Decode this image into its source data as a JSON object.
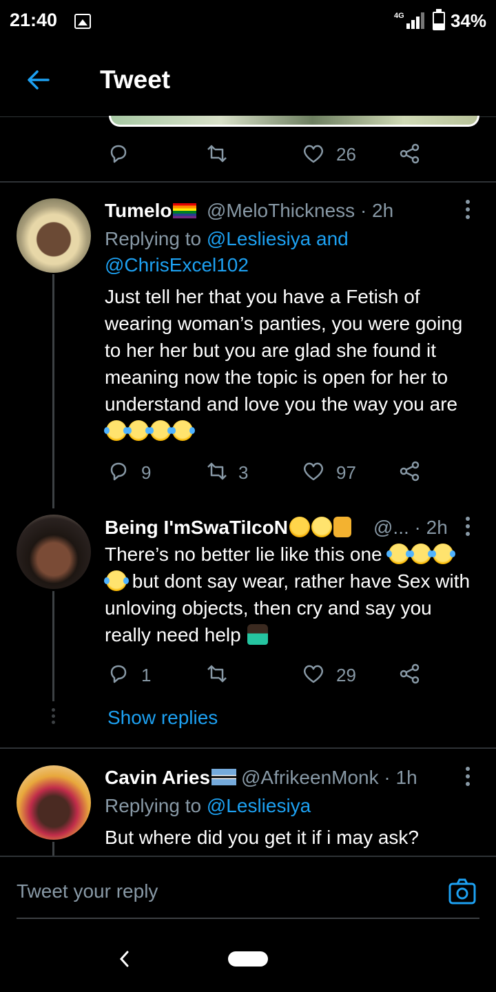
{
  "status_bar": {
    "time": "21:40",
    "network": "4G",
    "battery": "34%"
  },
  "header": {
    "title": "Tweet"
  },
  "main_tweet_actions": {
    "likes": "26"
  },
  "replies": [
    {
      "name": "Tumelo",
      "handle": "@MeloThickness",
      "time": "· 2h",
      "replying_prefix": "Replying to",
      "replying_mention1": "@Lesliesiya",
      "replying_and": "and",
      "replying_mention2": "@ChrisExcel102",
      "text": "Just tell her that you have a Fetish of wearing woman’s panties, you were going to her her but you are glad she found it meaning now the topic is open for her to understand and love you the way you are",
      "replies_count": "9",
      "retweets_count": "3",
      "likes_count": "97"
    },
    {
      "name": "Being I'mSwaTiIcoN",
      "handle": "@...",
      "time": "· 2h",
      "text_part1": "There’s no better lie like this one",
      "text_part2": "but dont say wear, rather have Sex with unloving objects, then cry and say you really need help",
      "replies_count": "1",
      "retweets_count": "",
      "likes_count": "29",
      "show_replies": "Show replies"
    },
    {
      "name": "Cavin Aries",
      "handle": "@AfrikeenMonk",
      "time": "· 1h",
      "replying_prefix": "Replying to",
      "replying_mention1": "@Lesliesiya",
      "text": "But where did you get it if i may ask?"
    }
  ],
  "compose": {
    "placeholder": "Tweet your reply"
  },
  "icons": [
    "arrow-left-icon",
    "reply-icon",
    "retweet-icon",
    "like-icon",
    "share-icon",
    "more-icon",
    "camera-icon",
    "gallery-icon",
    "signal-icon",
    "battery-icon"
  ],
  "colors": {
    "accent": "#1da1f2",
    "muted": "#8899a6",
    "background": "#000000"
  }
}
